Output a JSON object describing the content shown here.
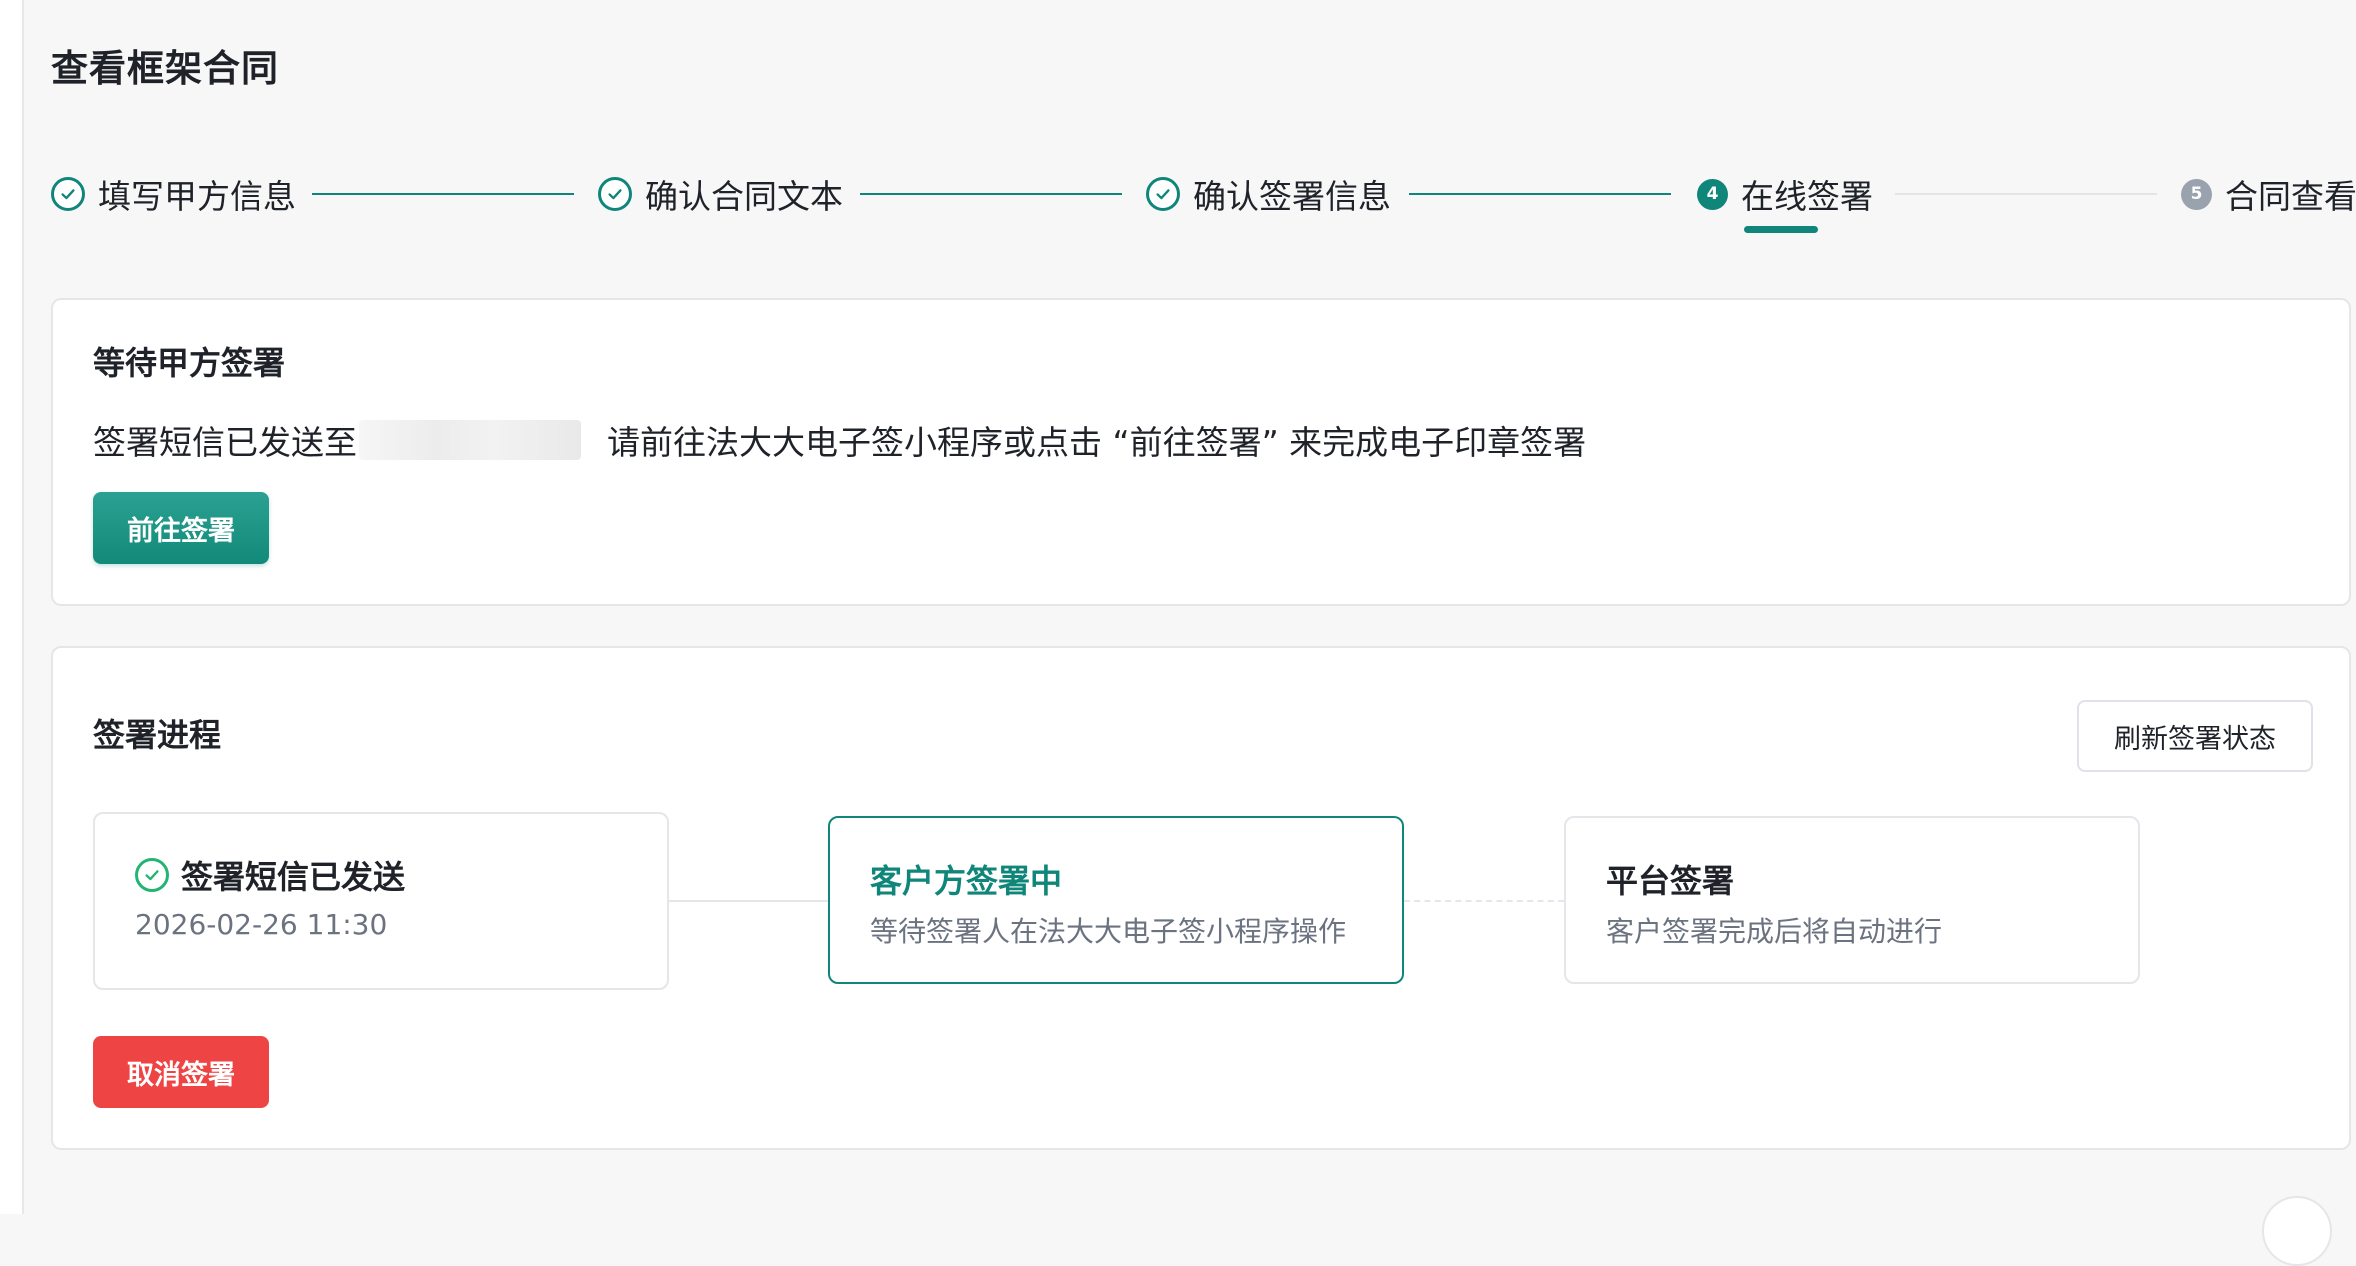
{
  "page": {
    "title": "查看框架合同"
  },
  "steps": [
    {
      "label": "填写甲方信息",
      "status": "done",
      "icon": "check-icon"
    },
    {
      "label": "确认合同文本",
      "status": "done",
      "icon": "check-icon"
    },
    {
      "label": "确认签署信息",
      "status": "done",
      "icon": "check-icon"
    },
    {
      "label": "在线签署",
      "status": "current",
      "number": "4"
    },
    {
      "label": "合同查看",
      "status": "pending",
      "number": "5"
    }
  ],
  "signing_notice": {
    "title": "等待甲方签署",
    "message_prefix": "签署短信已发送至",
    "message_suffix": "请前往法大大电子签小程序或点击 “前往签署” 来完成电子印章签署",
    "go_sign_label": "前往签署"
  },
  "signing_progress": {
    "title": "签署进程",
    "refresh_label": "刷新签署状态",
    "cancel_label": "取消签署",
    "nodes": [
      {
        "title": "签署短信已发送",
        "subtitle": "2026-02-26 11:30",
        "status": "done"
      },
      {
        "title": "客户方签署中",
        "subtitle": "等待签署人在法大大电子签小程序操作",
        "status": "active"
      },
      {
        "title": "平台签署",
        "subtitle": "客户签署完成后将自动进行",
        "status": "pending"
      }
    ]
  },
  "colors": {
    "primary": "#10857a",
    "success": "#22b573",
    "danger": "#ef4444",
    "pending": "#9aa3ad"
  }
}
